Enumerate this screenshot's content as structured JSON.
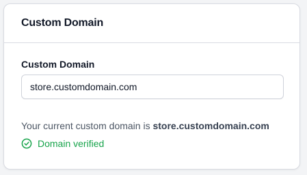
{
  "card": {
    "title": "Custom Domain"
  },
  "form": {
    "label": "Custom Domain",
    "input_value": "store.customdomain.com"
  },
  "current": {
    "prefix": "Your current custom domain is",
    "domain": "store.customdomain.com"
  },
  "status": {
    "text": "Domain verified",
    "icon": "check-circle-icon",
    "color": "#16a34a"
  }
}
